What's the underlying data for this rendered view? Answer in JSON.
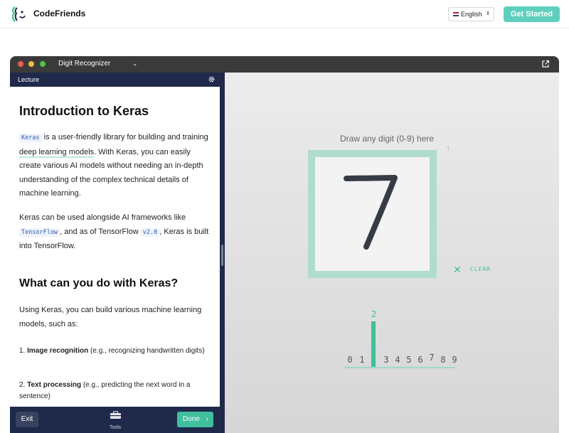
{
  "site": {
    "brand": "CodeFriends",
    "language": "English",
    "cta": "Get Started"
  },
  "window": {
    "title": "Digit Recognizer",
    "title_chevron": "⌄"
  },
  "lecture": {
    "panel_label": "Lecture",
    "title": "Introduction to Keras",
    "p1": {
      "code1": "Keras",
      "text1": " is a user-friendly library for building and training ",
      "highlight": "deep learning models",
      "text2": ". With Keras, you can easily create various AI models without needing an in-depth understanding of the complex technical details of machine learning."
    },
    "p2": {
      "text1": "Keras can be used alongside AI frameworks like ",
      "code1": "TensorFlow",
      "text2": ", and as of TensorFlow ",
      "code2": "v2.0",
      "text3": ", Keras is built into TensorFlow."
    },
    "heading2": "What can you do with Keras?",
    "p3": "Using Keras, you can build various machine learning models, such as:",
    "list": [
      {
        "num": "1. ",
        "bold": "Image recognition",
        "rest": " (e.g., recognizing handwritten digits)"
      },
      {
        "num": "2. ",
        "bold": "Text processing",
        "rest": " (e.g., predicting the next word in a sentence)"
      }
    ],
    "footer": {
      "exit": "Exit",
      "tools": "Tools",
      "done": "Done",
      "done_chevron": "›"
    }
  },
  "recognizer": {
    "hint": "Draw any digit (0-9) here",
    "clear_label": "CLEAR",
    "clear_icon": "✕",
    "predicted": "2",
    "digits": [
      "0",
      "1",
      "2",
      "3",
      "4",
      "5",
      "6",
      "7",
      "8",
      "9"
    ],
    "icons": [
      "logo-icon",
      "external-link-icon",
      "settings-icon",
      "tools-icon",
      "pencil-icon",
      "close-icon"
    ]
  },
  "colors": {
    "accent": "#3fbf9c",
    "cta": "#5fcfbd",
    "navy": "#1f2a4a",
    "frame": "#b0dccf"
  }
}
